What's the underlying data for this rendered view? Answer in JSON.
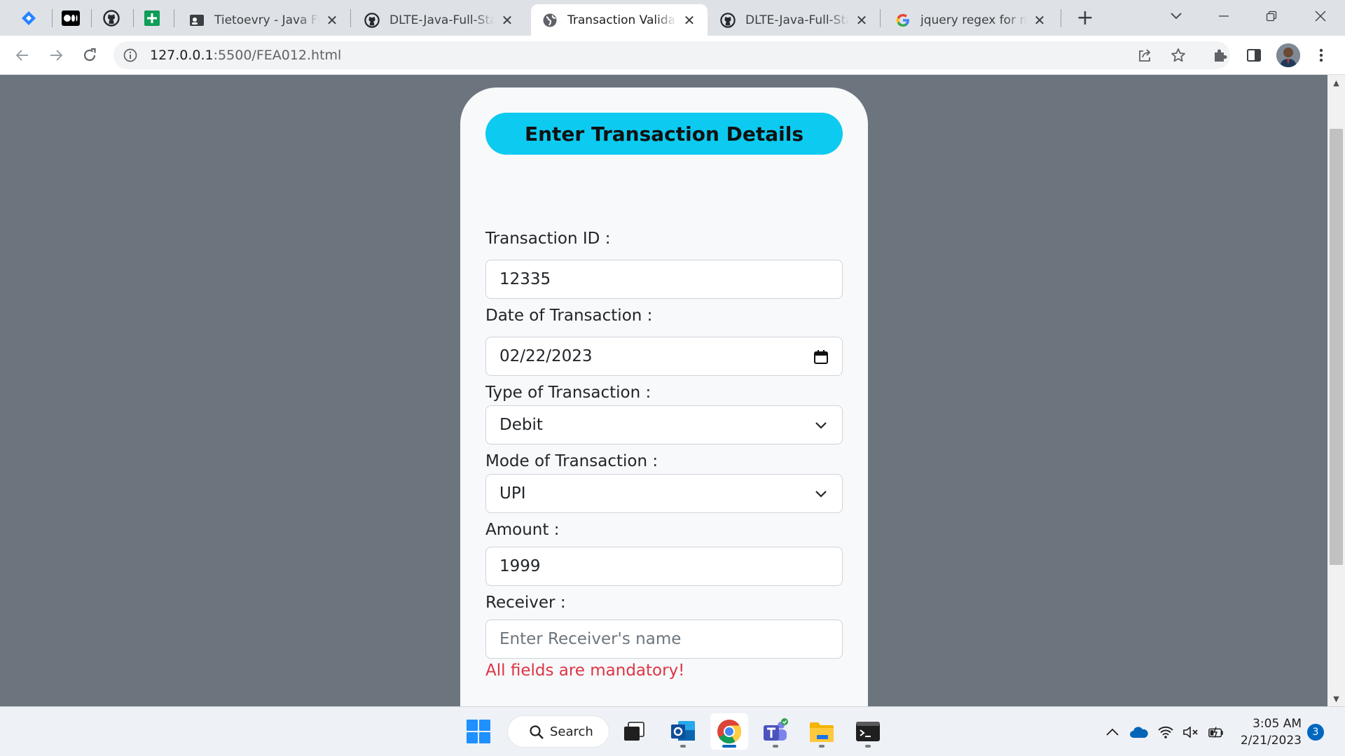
{
  "browser": {
    "tabs": [
      {
        "title": "Tietoevry - Java Full",
        "icon": "tietoevry-favicon"
      },
      {
        "title": "DLTE-Java-Full-Stack",
        "icon": "github-favicon"
      },
      {
        "title": "Transaction Validation",
        "icon": "globe-favicon",
        "active": true
      },
      {
        "title": "DLTE-Java-Full-Stack",
        "icon": "github-favicon"
      },
      {
        "title": "jquery regex for name",
        "icon": "google-favicon"
      }
    ],
    "pinned_tabs": [
      "jira-favicon",
      "medium-favicon",
      "github-favicon",
      "sheets-favicon"
    ],
    "url": {
      "host": "127.0.0.1",
      "path": ":5500/FEA012.html"
    }
  },
  "form": {
    "title": "Enter Transaction Details",
    "fields": {
      "transaction_id": {
        "label": "Transaction ID :",
        "value": "12335"
      },
      "date": {
        "label": "Date of Transaction :",
        "value": "02/22/2023"
      },
      "type": {
        "label": "Type of Transaction :",
        "value": "Debit"
      },
      "mode": {
        "label": "Mode of Transaction :",
        "value": "UPI"
      },
      "amount": {
        "label": "Amount :",
        "value": "1999"
      },
      "receiver": {
        "label": "Receiver :",
        "value": "",
        "placeholder": "Enter Receiver's name"
      }
    },
    "error": "All fields are mandatory!"
  },
  "taskbar": {
    "search_label": "Search",
    "time": "3:05 AM",
    "date": "2/21/2023",
    "notification_count": "3"
  },
  "colors": {
    "page_background": "#6c757d",
    "title_pill": "#0dcaf0",
    "error_text": "#dc3545"
  }
}
